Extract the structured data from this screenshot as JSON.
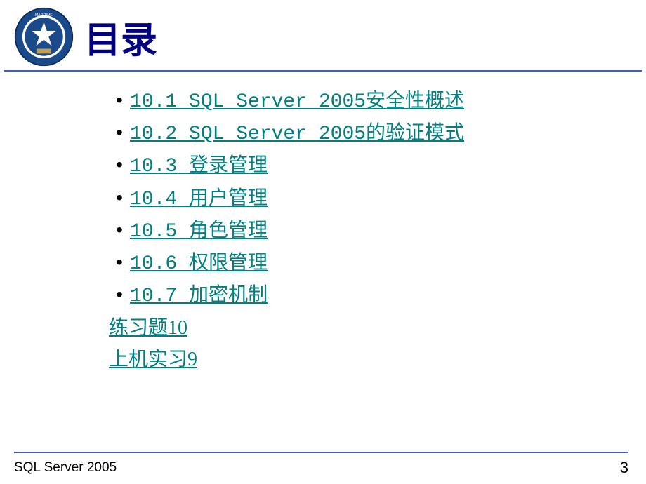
{
  "header": {
    "title": "目录"
  },
  "toc": {
    "items": [
      "10.1 SQL Server 2005安全性概述",
      "10.2 SQL Server 2005的验证模式",
      "10.3 登录管理",
      "10.4 用户管理",
      "10.5 角色管理",
      "10.6 权限管理",
      "10.7 加密机制"
    ],
    "extras": [
      "练习题10",
      " 上机实习9"
    ]
  },
  "footer": {
    "text": "SQL Server 2005",
    "page": "3"
  }
}
